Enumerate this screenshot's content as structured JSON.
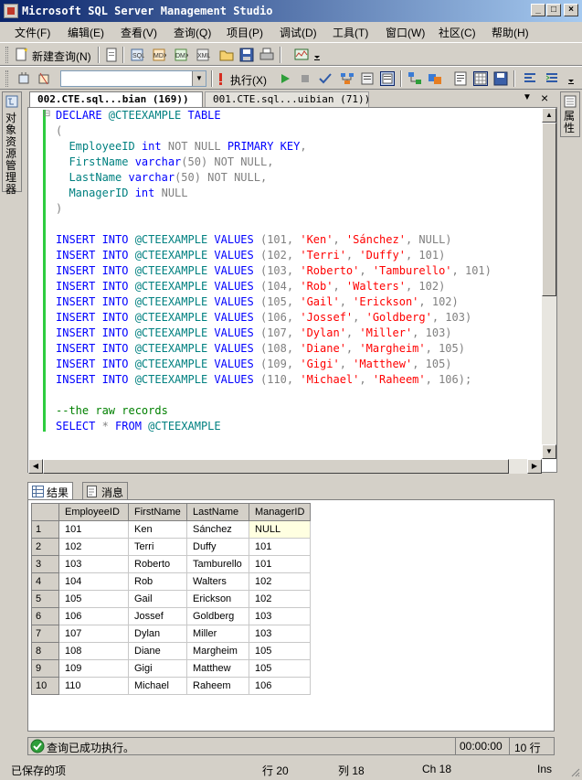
{
  "window": {
    "title": "Microsoft SQL Server Management Studio",
    "minimize": "_",
    "maximize": "□",
    "close": "×"
  },
  "menu": [
    "文件(F)",
    "编辑(E)",
    "查看(V)",
    "查询(Q)",
    "项目(P)",
    "调试(D)",
    "工具(T)",
    "窗口(W)",
    "社区(C)",
    "帮助(H)"
  ],
  "toolbar1": {
    "new_query": "新建查询(N)"
  },
  "toolbar2": {
    "database_value": "",
    "execute": "执行(X)"
  },
  "left_dock": {
    "label": "对象资源管理器"
  },
  "right_dock": {
    "label": "属性"
  },
  "doc_tabs": [
    {
      "label": "002.CTE.sql...bian (169))",
      "active": true
    },
    {
      "label": "001.CTE.sql...uibian (71))",
      "active": false
    }
  ],
  "doc_tab_controls": {
    "dropdown": "▼",
    "close": "×"
  },
  "code": [
    [
      [
        "kw",
        "DECLARE "
      ],
      [
        "tx",
        "@CTEEXAMPLE "
      ],
      [
        "kw",
        "TABLE"
      ]
    ],
    [
      [
        "gy",
        "("
      ]
    ],
    [
      [
        "bk",
        "  "
      ],
      [
        "tx",
        "EmployeeID "
      ],
      [
        "kw",
        "int "
      ],
      [
        "gy",
        "NOT NULL "
      ],
      [
        "kw",
        "PRIMARY KEY"
      ],
      [
        "gy",
        ","
      ]
    ],
    [
      [
        "bk",
        "  "
      ],
      [
        "tx",
        "FirstName "
      ],
      [
        "kw",
        "varchar"
      ],
      [
        "gy",
        "(50) NOT NULL,"
      ]
    ],
    [
      [
        "bk",
        "  "
      ],
      [
        "tx",
        "LastName "
      ],
      [
        "kw",
        "varchar"
      ],
      [
        "gy",
        "(50) NOT NULL,"
      ]
    ],
    [
      [
        "bk",
        "  "
      ],
      [
        "tx",
        "ManagerID "
      ],
      [
        "kw",
        "int "
      ],
      [
        "gy",
        "NULL"
      ]
    ],
    [
      [
        "gy",
        ")"
      ]
    ],
    [],
    [
      [
        "kw",
        "INSERT INTO "
      ],
      [
        "tx",
        "@CTEEXAMPLE "
      ],
      [
        "kw",
        "VALUES "
      ],
      [
        "gy",
        "(101, "
      ],
      [
        "st",
        "'Ken'"
      ],
      [
        "gy",
        ", "
      ],
      [
        "st",
        "'Sánchez'"
      ],
      [
        "gy",
        ", NULL)"
      ]
    ],
    [
      [
        "kw",
        "INSERT INTO "
      ],
      [
        "tx",
        "@CTEEXAMPLE "
      ],
      [
        "kw",
        "VALUES "
      ],
      [
        "gy",
        "(102, "
      ],
      [
        "st",
        "'Terri'"
      ],
      [
        "gy",
        ", "
      ],
      [
        "st",
        "'Duffy'"
      ],
      [
        "gy",
        ", 101)"
      ]
    ],
    [
      [
        "kw",
        "INSERT INTO "
      ],
      [
        "tx",
        "@CTEEXAMPLE "
      ],
      [
        "kw",
        "VALUES "
      ],
      [
        "gy",
        "(103, "
      ],
      [
        "st",
        "'Roberto'"
      ],
      [
        "gy",
        ", "
      ],
      [
        "st",
        "'Tamburello'"
      ],
      [
        "gy",
        ", 101)"
      ]
    ],
    [
      [
        "kw",
        "INSERT INTO "
      ],
      [
        "tx",
        "@CTEEXAMPLE "
      ],
      [
        "kw",
        "VALUES "
      ],
      [
        "gy",
        "(104, "
      ],
      [
        "st",
        "'Rob'"
      ],
      [
        "gy",
        ", "
      ],
      [
        "st",
        "'Walters'"
      ],
      [
        "gy",
        ", 102)"
      ]
    ],
    [
      [
        "kw",
        "INSERT INTO "
      ],
      [
        "tx",
        "@CTEEXAMPLE "
      ],
      [
        "kw",
        "VALUES "
      ],
      [
        "gy",
        "(105, "
      ],
      [
        "st",
        "'Gail'"
      ],
      [
        "gy",
        ", "
      ],
      [
        "st",
        "'Erickson'"
      ],
      [
        "gy",
        ", 102)"
      ]
    ],
    [
      [
        "kw",
        "INSERT INTO "
      ],
      [
        "tx",
        "@CTEEXAMPLE "
      ],
      [
        "kw",
        "VALUES "
      ],
      [
        "gy",
        "(106, "
      ],
      [
        "st",
        "'Jossef'"
      ],
      [
        "gy",
        ", "
      ],
      [
        "st",
        "'Goldberg'"
      ],
      [
        "gy",
        ", 103)"
      ]
    ],
    [
      [
        "kw",
        "INSERT INTO "
      ],
      [
        "tx",
        "@CTEEXAMPLE "
      ],
      [
        "kw",
        "VALUES "
      ],
      [
        "gy",
        "(107, "
      ],
      [
        "st",
        "'Dylan'"
      ],
      [
        "gy",
        ", "
      ],
      [
        "st",
        "'Miller'"
      ],
      [
        "gy",
        ", 103)"
      ]
    ],
    [
      [
        "kw",
        "INSERT INTO "
      ],
      [
        "tx",
        "@CTEEXAMPLE "
      ],
      [
        "kw",
        "VALUES "
      ],
      [
        "gy",
        "(108, "
      ],
      [
        "st",
        "'Diane'"
      ],
      [
        "gy",
        ", "
      ],
      [
        "st",
        "'Margheim'"
      ],
      [
        "gy",
        ", 105)"
      ]
    ],
    [
      [
        "kw",
        "INSERT INTO "
      ],
      [
        "tx",
        "@CTEEXAMPLE "
      ],
      [
        "kw",
        "VALUES "
      ],
      [
        "gy",
        "(109, "
      ],
      [
        "st",
        "'Gigi'"
      ],
      [
        "gy",
        ", "
      ],
      [
        "st",
        "'Matthew'"
      ],
      [
        "gy",
        ", 105)"
      ]
    ],
    [
      [
        "kw",
        "INSERT INTO "
      ],
      [
        "tx",
        "@CTEEXAMPLE "
      ],
      [
        "kw",
        "VALUES "
      ],
      [
        "gy",
        "(110, "
      ],
      [
        "st",
        "'Michael'"
      ],
      [
        "gy",
        ", "
      ],
      [
        "st",
        "'Raheem'"
      ],
      [
        "gy",
        ", 106);"
      ]
    ],
    [],
    [
      [
        "cm",
        "--the raw records"
      ]
    ],
    [
      [
        "kw",
        "SELECT "
      ],
      [
        "gy",
        "* "
      ],
      [
        "kw",
        "FROM "
      ],
      [
        "tx",
        "@CTEEXAMPLE"
      ]
    ]
  ],
  "result_tabs": [
    {
      "label": "结果",
      "icon": "grid-icon"
    },
    {
      "label": "消息",
      "icon": "message-icon"
    }
  ],
  "grid": {
    "columns": [
      "EmployeeID",
      "FirstName",
      "LastName",
      "ManagerID"
    ],
    "rows": [
      [
        "1",
        "101",
        "Ken",
        "Sánchez",
        "NULL"
      ],
      [
        "2",
        "102",
        "Terri",
        "Duffy",
        "101"
      ],
      [
        "3",
        "103",
        "Roberto",
        "Tamburello",
        "101"
      ],
      [
        "4",
        "104",
        "Rob",
        "Walters",
        "102"
      ],
      [
        "5",
        "105",
        "Gail",
        "Erickson",
        "102"
      ],
      [
        "6",
        "106",
        "Jossef",
        "Goldberg",
        "103"
      ],
      [
        "7",
        "107",
        "Dylan",
        "Miller",
        "103"
      ],
      [
        "8",
        "108",
        "Diane",
        "Margheim",
        "105"
      ],
      [
        "9",
        "109",
        "Gigi",
        "Matthew",
        "105"
      ],
      [
        "10",
        "110",
        "Michael",
        "Raheem",
        "106"
      ]
    ]
  },
  "query_status": {
    "message": "查询已成功执行。",
    "elapsed": "00:00:00",
    "rows": "10 行"
  },
  "statusbar": {
    "state": "已保存的项",
    "line": "行 20",
    "col": "列 18",
    "ch": "Ch 18",
    "mode": "Ins"
  }
}
